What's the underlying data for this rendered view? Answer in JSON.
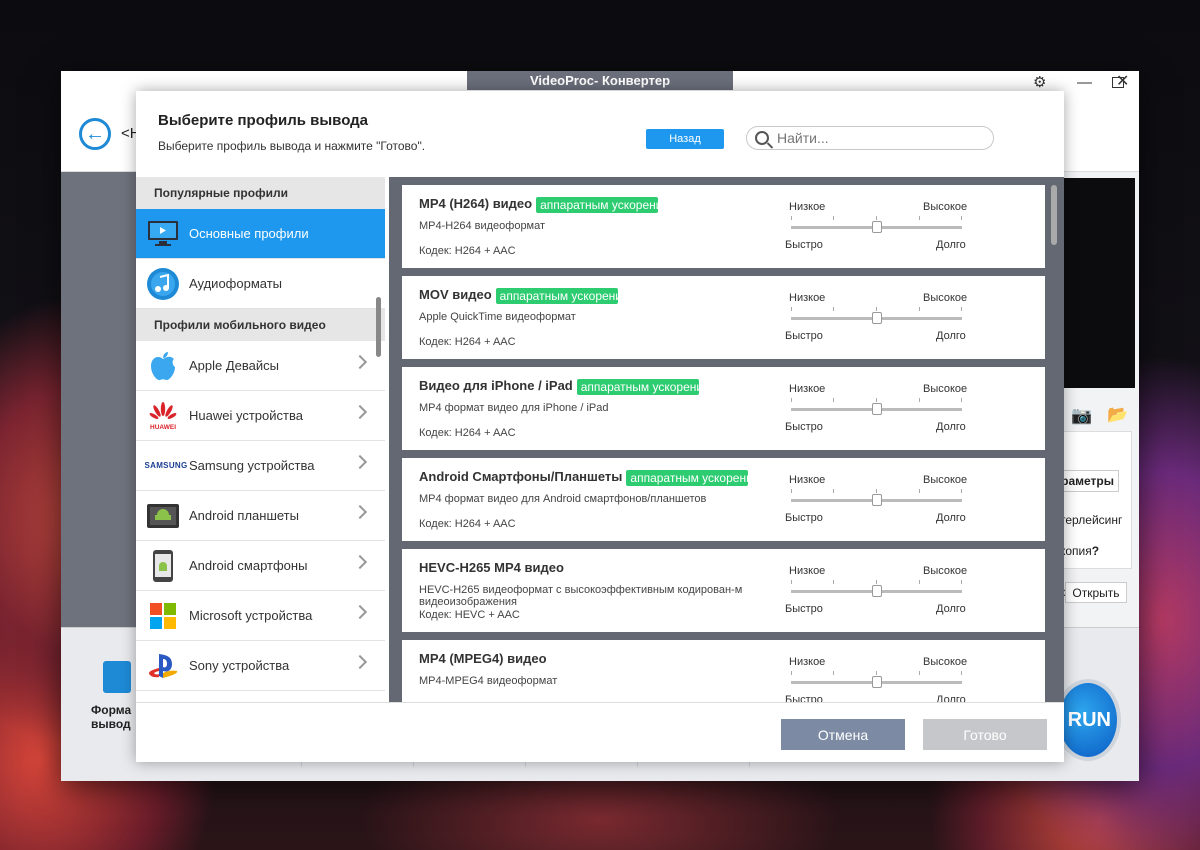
{
  "window": {
    "title": "VideoProc- Конвертер",
    "back_label": "<H"
  },
  "dialog": {
    "title": "Выберите профиль вывода",
    "subtitle": "Выберите профиль вывода и нажмите \"Готово\".",
    "back_button": "Назад",
    "search_placeholder": "Найти...",
    "cancel_button": "Отмена",
    "done_button": "Готово"
  },
  "sidebar": {
    "popular_header": "Популярные профили",
    "popular": [
      {
        "label": "Основные профили",
        "icon": "monitor-icon",
        "active": true
      },
      {
        "label": "Аудиоформаты",
        "icon": "music-note-icon"
      }
    ],
    "mobile_header": "Профили мобильного видео",
    "mobile": [
      {
        "label": "Apple Девайсы",
        "icon": "apple-icon"
      },
      {
        "label": "Huawei устройства",
        "icon": "huawei-icon",
        "logo_text": "HUAWEI"
      },
      {
        "label": "Samsung устройства",
        "icon": "samsung-icon",
        "logo_text": "SAMSUNG"
      },
      {
        "label": "Android планшеты",
        "icon": "android-tablet-icon"
      },
      {
        "label": "Android смартфоны",
        "icon": "android-phone-icon"
      },
      {
        "label": "Microsoft устройства",
        "icon": "microsoft-icon"
      },
      {
        "label": "Sony устройства",
        "icon": "playstation-icon"
      }
    ]
  },
  "quality": {
    "low": "Низкое",
    "high": "Высокое",
    "fast": "Быстро",
    "slow": "Долго"
  },
  "profiles": [
    {
      "name": "MP4 (H264) видео",
      "badge": "аппаратным ускорени",
      "desc": "MP4-H264 видеоформат",
      "codec": "Кодек: H264 + AAC",
      "quality_level": 0.5
    },
    {
      "name": "MOV видео",
      "badge": "аппаратным ускорени",
      "desc": "Apple QuickTime видеоформат",
      "codec": "Кодек: H264 + AAC",
      "quality_level": 0.5
    },
    {
      "name": "Видео для iPhone / iPad",
      "badge": "аппаратным ускорени",
      "desc": "MP4 формат видео для iPhone / iPad",
      "codec": "Кодек: H264 + AAC",
      "quality_level": 0.5
    },
    {
      "name": "Android Смартфоны/Планшеты",
      "badge": "аппаратным ускорени",
      "desc": "MP4 формат видео для Android смартфонов/планшетов",
      "codec": "Кодек: H264 + AAC",
      "quality_level": 0.5
    },
    {
      "name": "HEVC-H265 MP4 видео",
      "badge": "",
      "desc": "HEVC-H265 видеоформат с высокоэффективным кодирован-м видеоизображения",
      "codec": "Кодек: HEVC + AAC",
      "quality_level": 0.5
    },
    {
      "name": "MP4 (MPEG4) видео",
      "badge": "",
      "desc": "MP4-MPEG4 видеоформат",
      "codec": "",
      "quality_level": 0.5
    }
  ],
  "background_app": {
    "params_button": "раметры",
    "interlace_text": "терлейсинг",
    "copy_text": "копия",
    "copy_help": "?",
    "open_button": "Открыть",
    "open_prefix": "о",
    "format_label_line1": "Форма",
    "format_label_line2": "вывод",
    "run_button": "RUN"
  }
}
